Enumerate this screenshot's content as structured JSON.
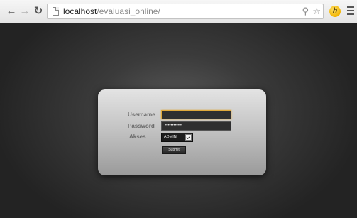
{
  "browser": {
    "url_host": "localhost",
    "url_path": "/evaluasi_online/"
  },
  "login": {
    "username_label": "Username",
    "password_label": "Password",
    "akses_label": "Akses",
    "username_value": "",
    "password_value": "••••••••••••",
    "akses_selected": "ADMIN",
    "submit_label": "Submit"
  }
}
